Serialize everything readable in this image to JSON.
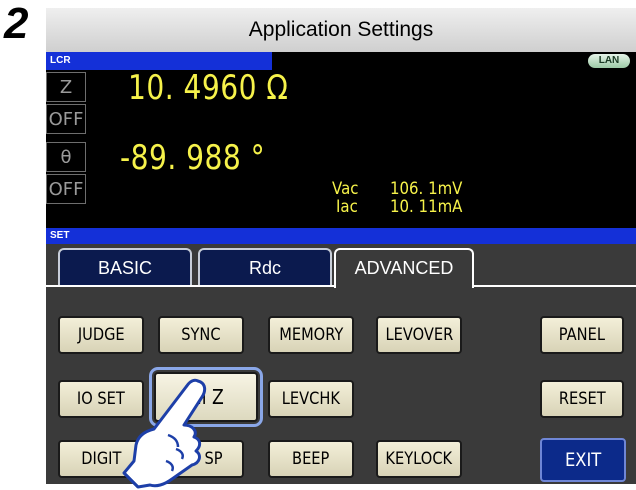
{
  "step_number": "2",
  "window": {
    "title": "Application Settings"
  },
  "lcr_strip": {
    "label": "LCR",
    "lan_badge": "LAN"
  },
  "measurement": {
    "param1": {
      "name": "Z",
      "value": "10. 4960 Ω",
      "status": "OFF"
    },
    "param2": {
      "name": "θ",
      "value": "-89. 988 °",
      "status": "OFF"
    },
    "monitor": {
      "vac_label": "Vac",
      "vac_value": "106. 1mV",
      "iac_label": "Iac",
      "iac_value": "10. 11mA"
    }
  },
  "set_strip": {
    "label": "SET"
  },
  "tabs": [
    {
      "label": "BASIC",
      "active": false
    },
    {
      "label": "Rdc",
      "active": false
    },
    {
      "label": "ADVANCED",
      "active": true
    }
  ],
  "buttons": {
    "judge": "JUDGE",
    "sync": "SYNC",
    "memory": "MEMORY",
    "levover": "LEVOVER",
    "panel": "PANEL",
    "io_set": "IO SET",
    "hi_z": "Hi  Z",
    "levchk": "LEVCHK",
    "reset": "RESET",
    "digit": "DIGIT",
    "disp": "DISP",
    "disp_visible": "SP",
    "beep": "BEEP",
    "keylock": "KEYLOCK",
    "exit": "EXIT"
  },
  "colors": {
    "display_value": "#f6f24a",
    "strip_blue": "#1430d8",
    "button_face": "#e9e5cc",
    "exit_button": "#0c2a8a",
    "highlight": "#8aa7e8"
  },
  "icons": {
    "pointer": "pointing-hand-icon"
  }
}
